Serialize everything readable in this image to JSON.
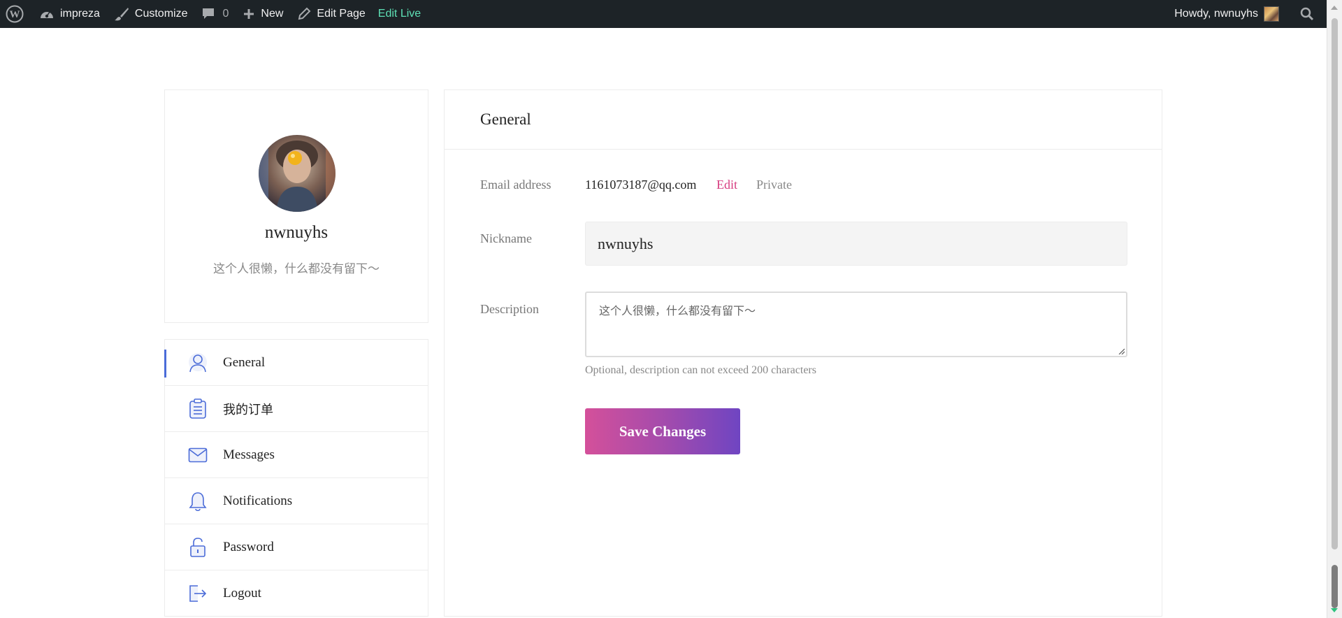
{
  "adminbar": {
    "site_name": "impreza",
    "customize": "Customize",
    "comments_count": "0",
    "new": "New",
    "edit_page": "Edit Page",
    "edit_live": "Edit Live",
    "howdy": "Howdy, nwnuyhs",
    "edit_live_color": "#5ee0b5"
  },
  "profile": {
    "name": "nwnuyhs",
    "description": "这个人很懒，什么都没有留下～"
  },
  "nav": {
    "items": [
      {
        "label": "General",
        "icon": "user-icon",
        "active": true
      },
      {
        "label": "我的订单",
        "icon": "clipboard-icon",
        "active": false
      },
      {
        "label": "Messages",
        "icon": "envelope-icon",
        "active": false
      },
      {
        "label": "Notifications",
        "icon": "bell-icon",
        "active": false
      },
      {
        "label": "Password",
        "icon": "lock-icon",
        "active": false
      },
      {
        "label": "Logout",
        "icon": "logout-icon",
        "active": false
      }
    ],
    "accent_color": "#4b6cd8"
  },
  "panel": {
    "title": "General",
    "email_label": "Email address",
    "email_value": "1161073187@qq.com",
    "email_edit": "Edit",
    "email_private": "Private",
    "nickname_label": "Nickname",
    "nickname_value": "nwnuyhs",
    "description_label": "Description",
    "description_value": "这个人很懒，什么都没有留下～",
    "description_hint": "Optional, description can not exceed 200 characters",
    "save_label": "Save Changes",
    "link_color": "#d63b7f"
  }
}
